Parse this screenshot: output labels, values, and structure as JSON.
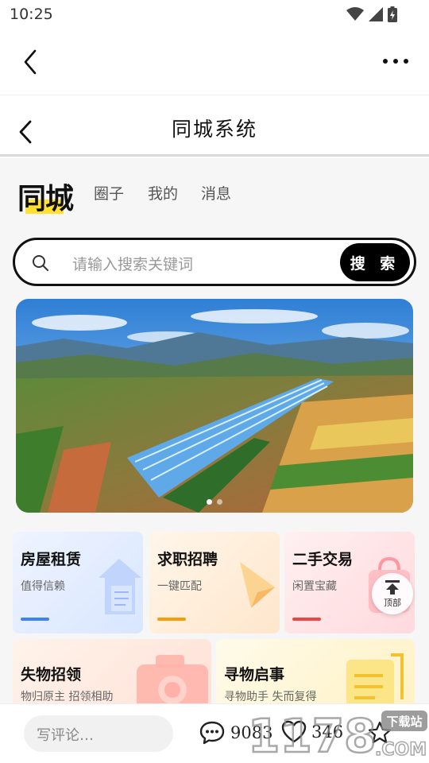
{
  "status_bar": {
    "time": "10:25"
  },
  "inner_nav": {
    "title": "同城系统"
  },
  "brand": {
    "name": "同城",
    "tabs": [
      "圈子",
      "我的",
      "消息"
    ]
  },
  "search": {
    "placeholder": "请输入搜索关键词",
    "button_label": "搜 索"
  },
  "banner": {
    "page_count": 2,
    "active_index": 0
  },
  "categories": [
    {
      "title": "房屋租赁",
      "subtitle": "值得信赖",
      "accent": "#3b82f6",
      "bg": "#e6efff"
    },
    {
      "title": "求职招聘",
      "subtitle": "一键匹配",
      "accent": "#f59e0b",
      "bg": "#fff1e0"
    },
    {
      "title": "二手交易",
      "subtitle": "闲置宝藏",
      "accent": "#ef4444",
      "bg": "#ffe8ea"
    },
    {
      "title": "失物招领",
      "subtitle": "物归原主 招领相助",
      "accent": "#ef4444",
      "bg": "#ffece4"
    },
    {
      "title": "寻物启事",
      "subtitle": "寻物助手 失而复得",
      "accent": "#f2c230",
      "bg": "#fff8dc"
    }
  ],
  "back_to_top": {
    "label": "顶部"
  },
  "bottom_bar": {
    "comment_placeholder": "写评论…",
    "comment_count": "9083",
    "like_count": "346"
  },
  "watermark": {
    "brand": "1178",
    "suffix": ".COM",
    "badge": "下载站"
  }
}
